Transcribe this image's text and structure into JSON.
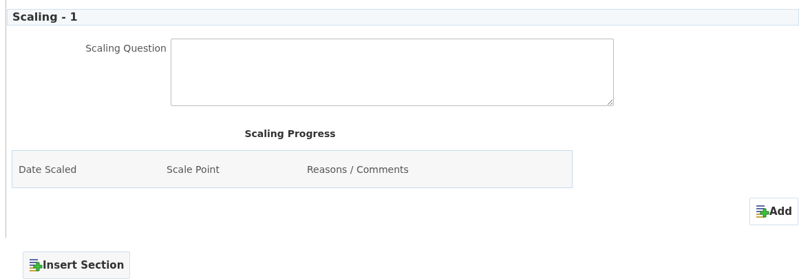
{
  "section": {
    "title": "Scaling - 1"
  },
  "question": {
    "label": "Scaling Question"
  },
  "progress": {
    "title": "Scaling Progress",
    "columns": [
      "Date Scaled",
      "Scale Point",
      "Reasons / Comments"
    ]
  },
  "buttons": {
    "add": "Add",
    "insert": "Insert Section"
  }
}
